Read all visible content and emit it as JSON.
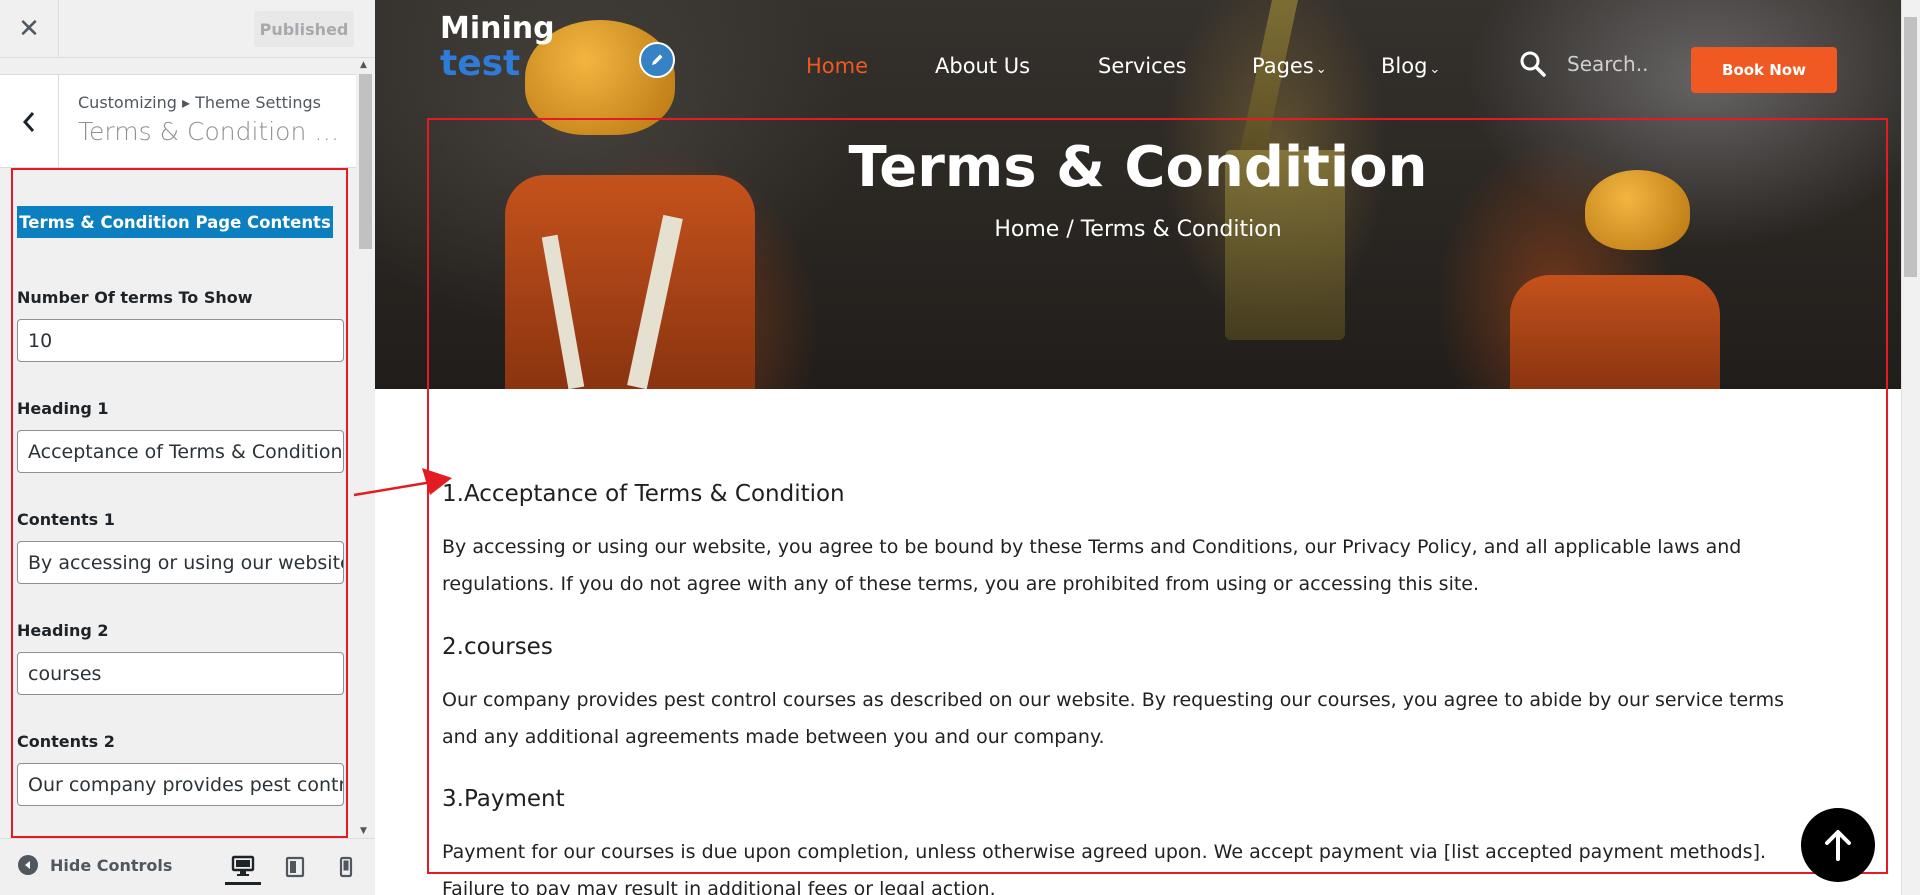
{
  "customizer": {
    "close_icon": "close-icon",
    "published_label": "Published",
    "breadcrumb": "Customizing ▸ Theme Settings",
    "section_title": "Terms & Condition Pa…",
    "section_badge": "Terms & Condition Page Contents",
    "controls": [
      {
        "label": "Number Of terms To Show",
        "value": "10"
      },
      {
        "label": "Heading 1",
        "value": "Acceptance of Terms & Condition"
      },
      {
        "label": "Contents 1",
        "value": "By accessing or using our website"
      },
      {
        "label": "Heading 2",
        "value": "courses"
      },
      {
        "label": "Contents 2",
        "value": "Our company provides pest contro"
      }
    ],
    "hide_controls_label": "Hide Controls"
  },
  "site": {
    "logo_top": "Mining",
    "logo_bottom": "test",
    "nav": {
      "home": "Home",
      "about": "About Us",
      "services": "Services",
      "pages": "Pages",
      "blog": "Blog"
    },
    "search_placeholder": "Search..",
    "book_now": "Book Now",
    "accent_color": "#f05a22",
    "hero_title": "Terms & Condition",
    "hero_breadcrumb": "Home / Terms & Condition"
  },
  "terms": [
    {
      "heading": "1.Acceptance of Terms & Condition",
      "body": "By accessing or using our website, you agree to be bound by these Terms and Conditions, our Privacy Policy, and all applicable laws and regulations. If you do not agree with any of these terms, you are prohibited from using or accessing this site."
    },
    {
      "heading": "2.courses",
      "body": "Our company provides pest control courses as described on our website. By requesting our courses, you agree to abide by our service terms and any additional agreements made between you and our company."
    },
    {
      "heading": "3.Payment",
      "body": "Payment for our courses is due upon completion, unless otherwise agreed upon. We accept payment via [list accepted payment methods]. Failure to pay may result in additional fees or legal action."
    }
  ]
}
